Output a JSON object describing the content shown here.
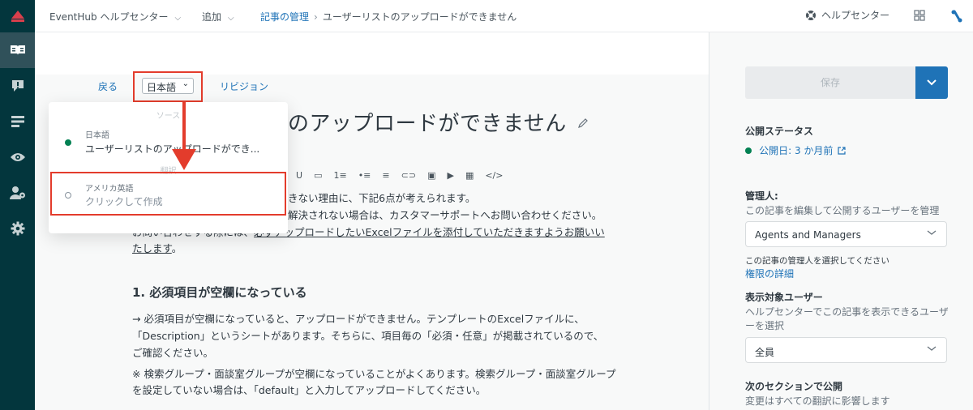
{
  "topbar": {
    "help_center": "EventHub ヘルプセンター",
    "add": "追加",
    "breadcrumb_manage": "記事の管理",
    "breadcrumb_current": "ユーザーリストのアップロードができません",
    "help_link": "ヘルプセンター"
  },
  "leftnav": {
    "items": [
      "guide-icon",
      "alert-icon",
      "list-icon",
      "eye-icon",
      "user-gear-icon",
      "settings-icon"
    ],
    "active_index": 0
  },
  "editor": {
    "back": "戻る",
    "language": "日本語",
    "revisions": "リビジョン",
    "title": "のアップロードができません",
    "toolbar": [
      "U",
      "▭",
      "1≡",
      "•≡",
      "≡",
      "⊂⊃",
      "▣",
      "▶",
      "▦",
      "</>"
    ],
    "intro_line1": "きない理由に、下記6点が考えられます。",
    "intro_line2": "解決されない場合は、カスタマーサポートへお問い合わせください。",
    "intro_line3_a": "お問い合わせする際には、",
    "intro_line3_b": "必ずアップロードしたいExcelファイルを添付していただきますようお願いい",
    "intro_line4_a": "たします",
    "intro_line4_b": "。",
    "heading1": "1. 必須項目が空欄になっている",
    "para1_line1": "→ 必須項目が空欄になっていると、アップロードができません。テンプレートのExcelファイルに、",
    "para1_line2": "「Description」というシートがあります。そちらに、項目毎の「必須・任意」が掲載されているので、",
    "para1_line3": "ご確認ください。",
    "para2_line1": "※ 検索グループ・面談室グループが空欄になっていることがよくあります。検索グループ・面談室グループ",
    "para2_line2": "を設定していない場合は、「default」と入力してアップロードしてください。"
  },
  "language_dropdown": {
    "source_header": "ソース",
    "source_lang": "日本語",
    "source_title": "ユーザーリストのアップロードができ...",
    "translation_header": "翻訳",
    "translation_lang": "アメリカ英語",
    "translation_action": "クリックして作成"
  },
  "sidebar": {
    "save": "保存",
    "publish_status_label": "公開ステータス",
    "publish_status_value": "公開日: 3 か月前",
    "manager_label": "管理人:",
    "manager_hint": "この記事を編集して公開するユーザーを管理",
    "manager_value": "Agents and Managers",
    "manager_select_hint": "この記事の管理人を選択してください",
    "permissions_link": "権限の詳細",
    "viewers_label": "表示対象ユーザー",
    "viewers_hint_1": "ヘルプセンターでこの記事を表示できるユーザ",
    "viewers_hint_2": "ーを選択",
    "viewers_value": "全員",
    "publish_section_label": "次のセクションで公開",
    "publish_section_hint": "変更はすべての翻訳に影響します"
  },
  "colors": {
    "nav_bg": "#03363d",
    "accent_blue": "#1f73b7",
    "status_green": "#038153",
    "annotation_red": "#e33c2c",
    "logo_red": "#d93f4c"
  }
}
